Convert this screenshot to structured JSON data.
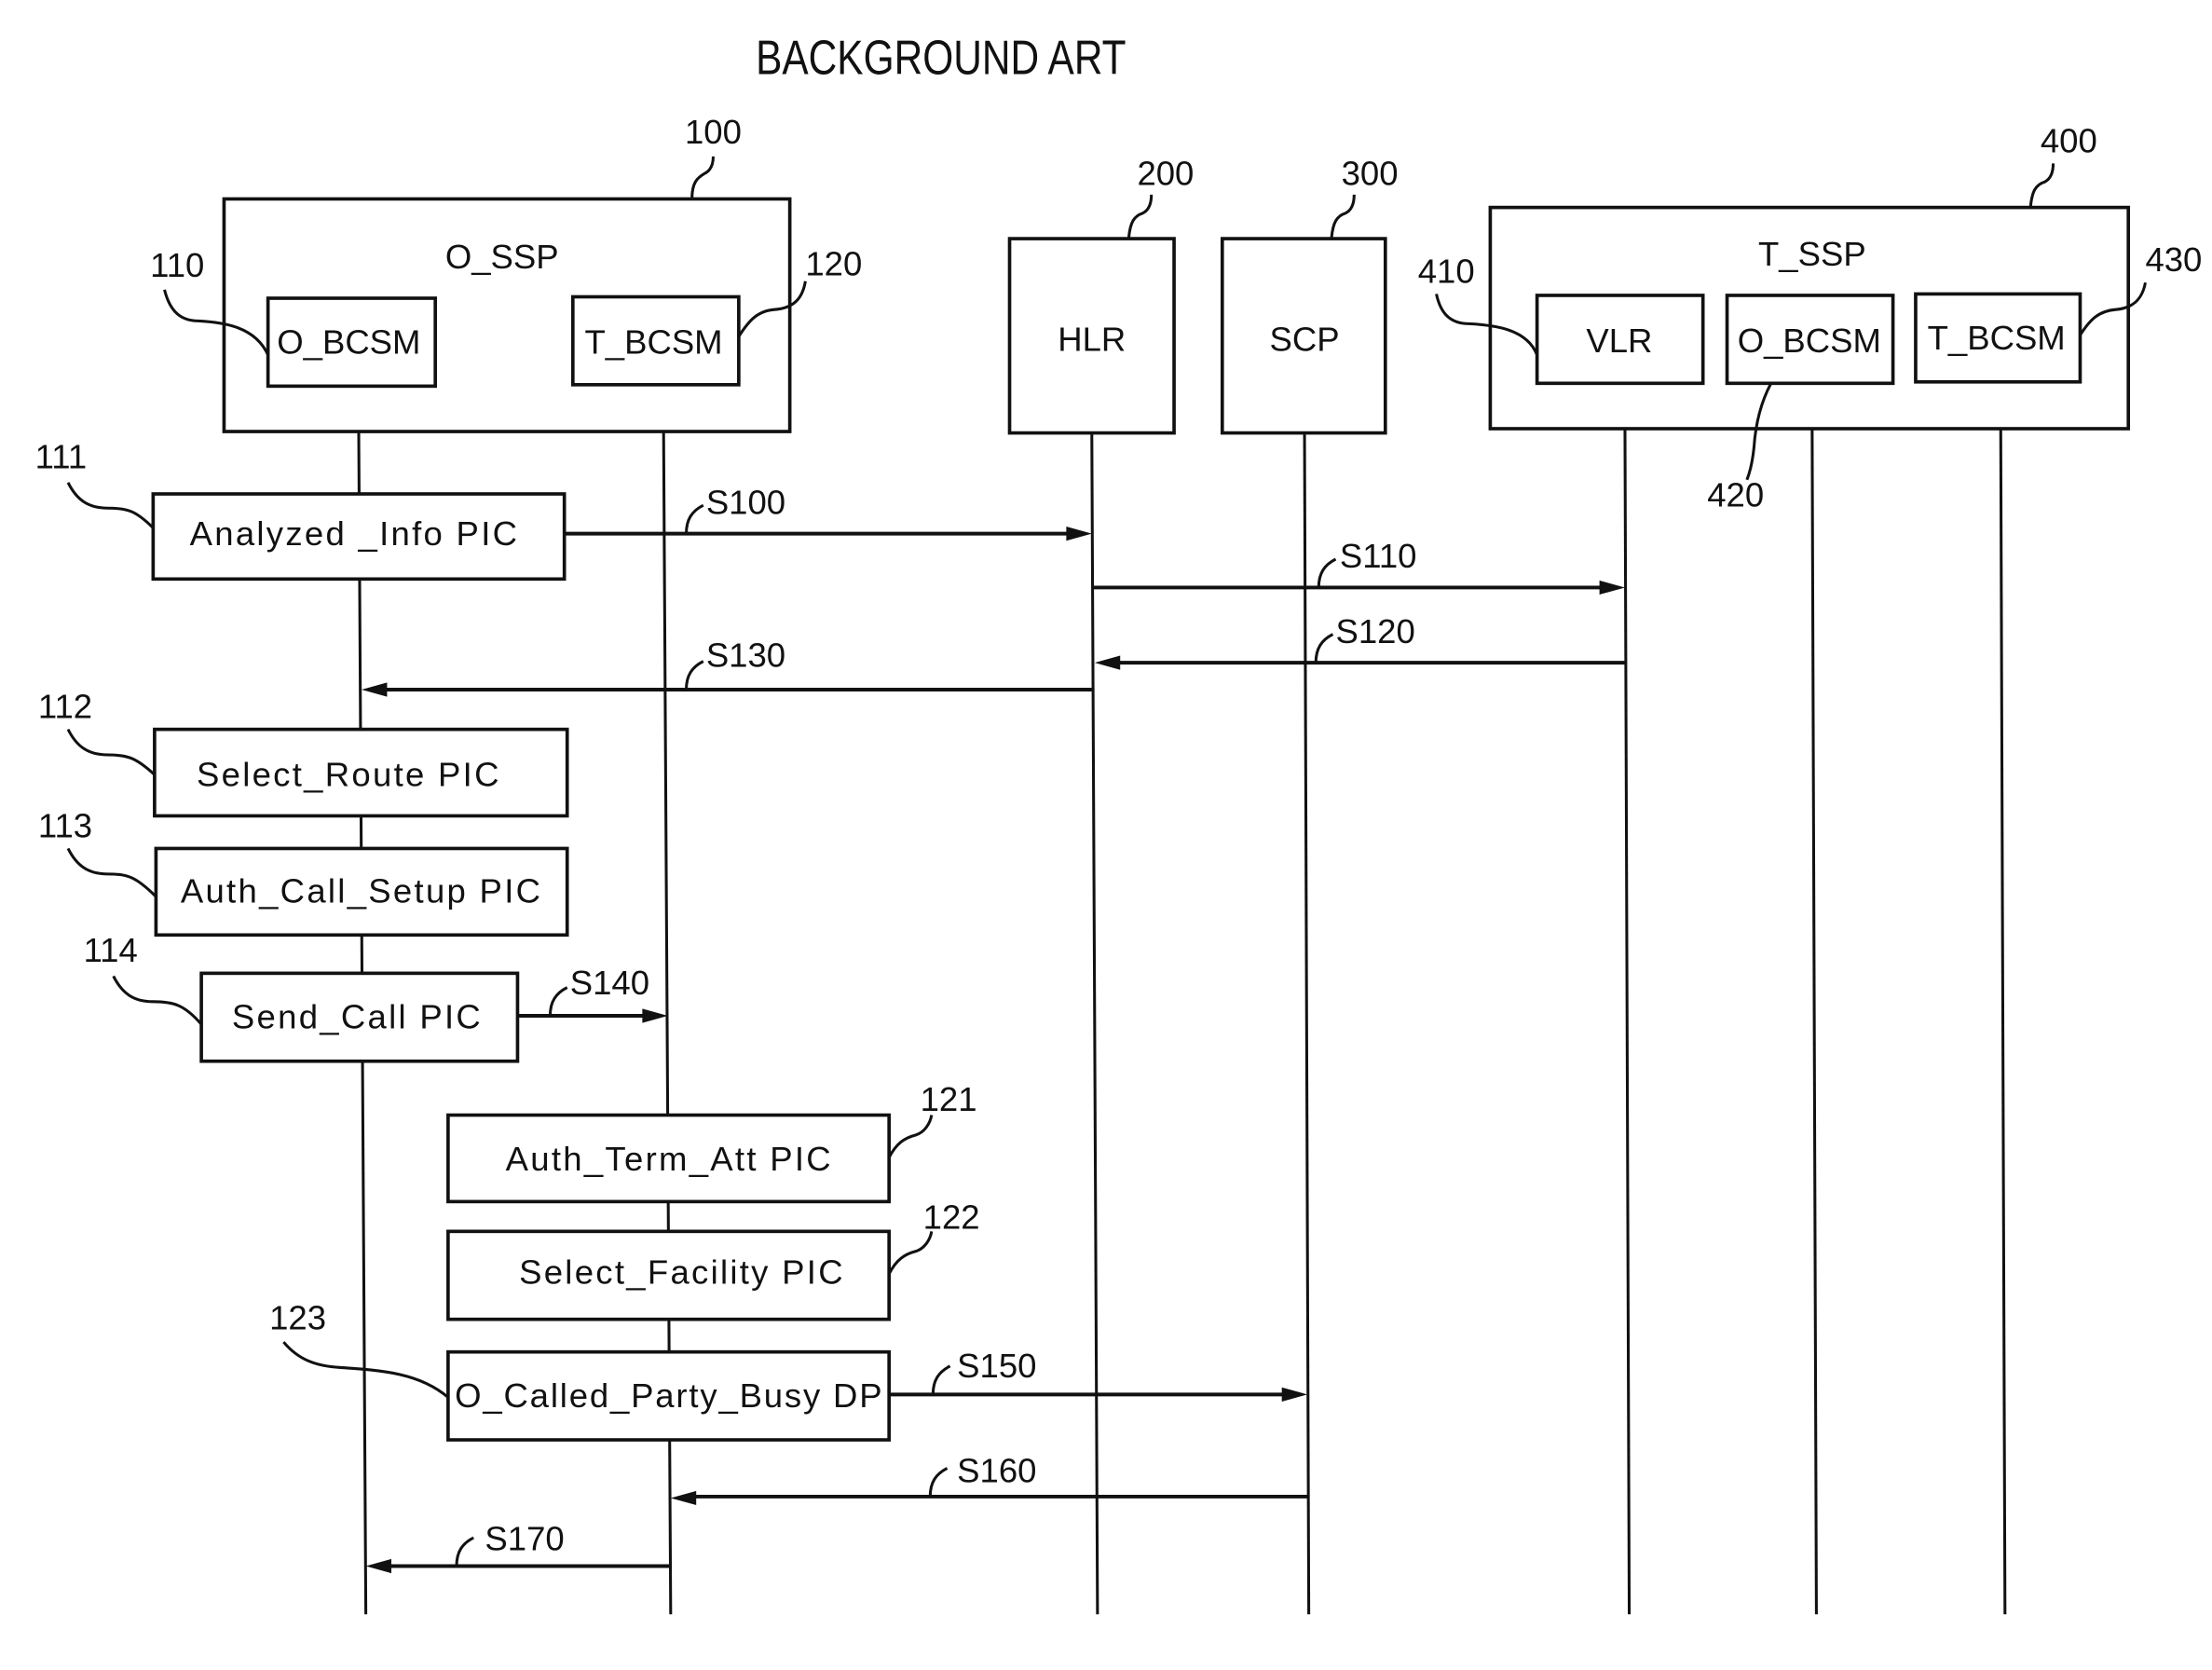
{
  "title": "BACKGROUND ART",
  "entities": [
    {
      "ref": "100",
      "label": "O_SSP"
    },
    {
      "ref": "110",
      "label": "O_BCSM"
    },
    {
      "ref": "120",
      "label": "T_BCSM"
    },
    {
      "ref": "200",
      "label": "HLR"
    },
    {
      "ref": "300",
      "label": "SCP"
    },
    {
      "ref": "400",
      "label": "T_SSP"
    },
    {
      "ref": "410",
      "label": "VLR"
    },
    {
      "ref": "420",
      "label": "O_BCSM"
    },
    {
      "ref": "430",
      "label": "T_BCSM"
    }
  ],
  "states": [
    {
      "ref": "111",
      "label": "Analyzed _Info PIC"
    },
    {
      "ref": "112",
      "label": "Select_Route PIC"
    },
    {
      "ref": "113",
      "label": "Auth_Call_Setup PIC"
    },
    {
      "ref": "114",
      "label": "Send_Call PIC"
    },
    {
      "ref": "121",
      "label": "Auth_Term_Att PIC"
    },
    {
      "ref": "122",
      "label": "Select_Facility PIC"
    },
    {
      "ref": "123",
      "label": "O_Called_Party_Busy DP"
    }
  ],
  "messages": [
    {
      "label": "S100",
      "from": "Analyzed _Info PIC",
      "to": "HLR"
    },
    {
      "label": "S110",
      "from": "HLR",
      "to": "VLR"
    },
    {
      "label": "S120",
      "from": "VLR",
      "to": "HLR"
    },
    {
      "label": "S130",
      "from": "HLR",
      "to": "O_BCSM"
    },
    {
      "label": "S140",
      "from": "Send_Call PIC",
      "to": "T_BCSM"
    },
    {
      "label": "S150",
      "from": "O_Called_Party_Busy DP",
      "to": "SCP"
    },
    {
      "label": "S160",
      "from": "SCP",
      "to": "T_BCSM"
    },
    {
      "label": "S170",
      "from": "T_BCSM",
      "to": "O_BCSM"
    }
  ]
}
